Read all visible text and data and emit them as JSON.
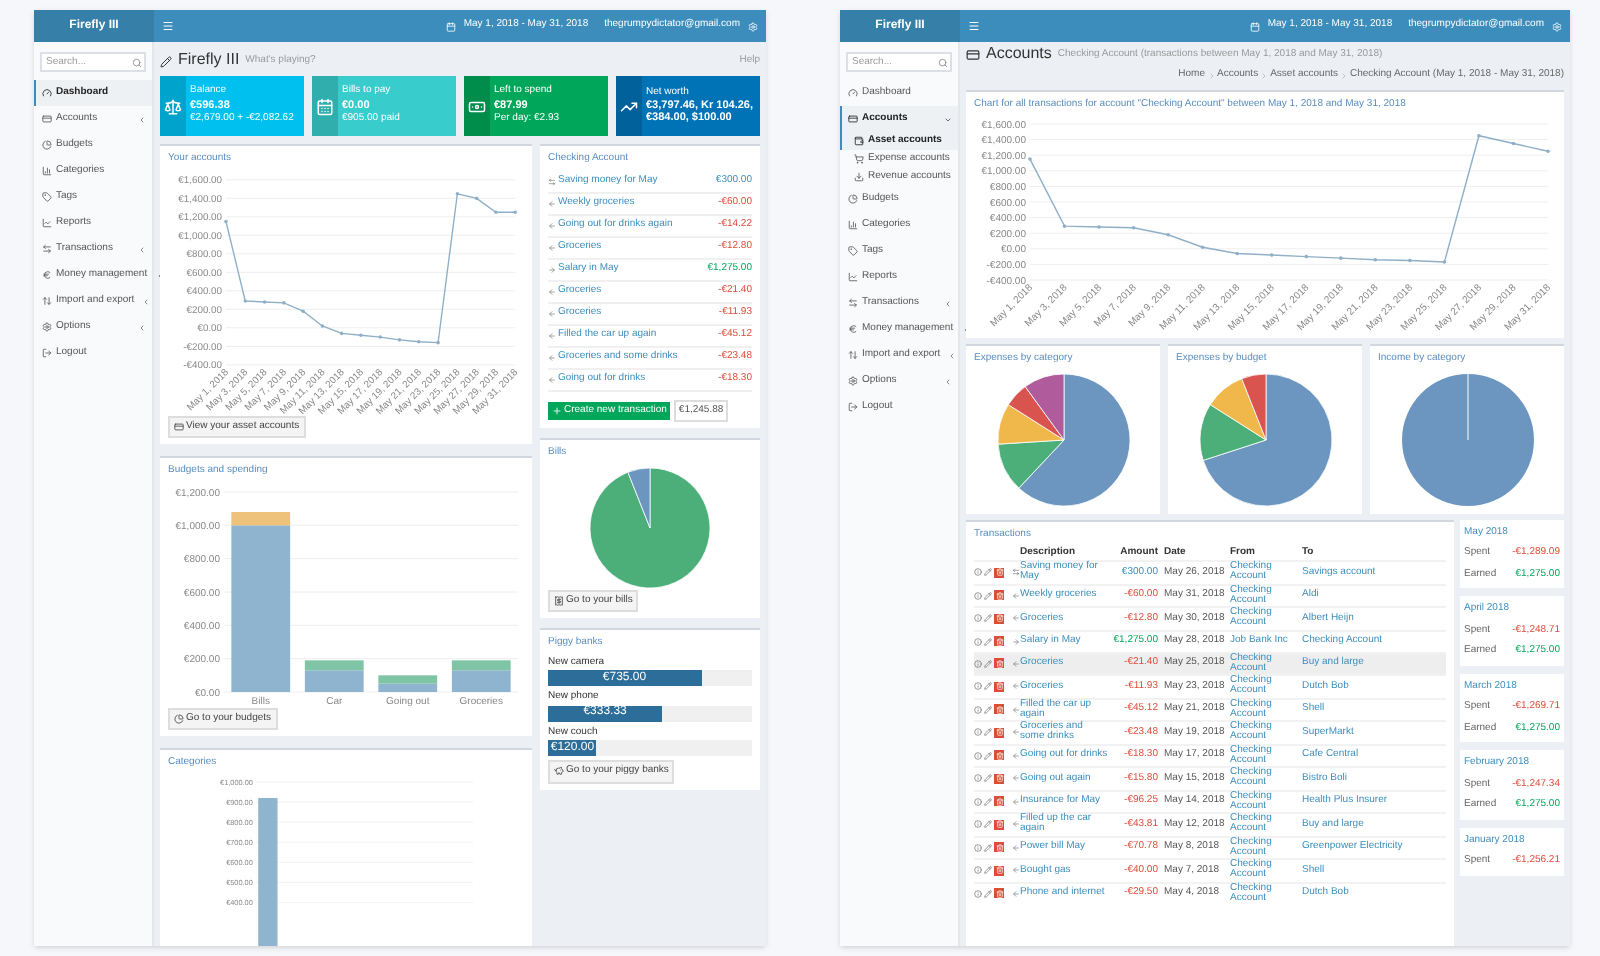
{
  "dashboard": {
    "header": {
      "brand": "Firefly III",
      "date_range": "May 1, 2018 - May 31, 2018",
      "user": "thegrumpydictator@gmail.com"
    },
    "search": {
      "placeholder": "Search..."
    },
    "menu": [
      {
        "kind": "dashboard",
        "label": "Dashboard",
        "selected": true
      },
      {
        "kind": "accounts",
        "label": "Accounts",
        "selected": false,
        "expanded": false
      },
      {
        "kind": "budgets",
        "label": "Budgets",
        "selected": false
      },
      {
        "kind": "categories",
        "label": "Categories",
        "selected": false
      },
      {
        "kind": "tags",
        "label": "Tags",
        "selected": false
      },
      {
        "kind": "reports",
        "label": "Reports",
        "selected": false
      },
      {
        "kind": "transactions",
        "label": "Transactions",
        "selected": false,
        "expanded": false
      },
      {
        "kind": "money",
        "label": "Money management",
        "selected": false,
        "expanded": false
      },
      {
        "kind": "import",
        "label": "Import and export",
        "selected": false,
        "expanded": false
      },
      {
        "kind": "options",
        "label": "Options",
        "selected": false,
        "expanded": false
      },
      {
        "kind": "logout",
        "label": "Logout",
        "selected": false
      }
    ],
    "title": "Firefly III",
    "subtitle": "What's playing?",
    "help": "Help",
    "info_boxes": [
      {
        "kind": "balance",
        "color": "#00c0ef",
        "label": "Balance",
        "value": "€596.38",
        "detail": "€2,679.00 + -€2,082.62"
      },
      {
        "kind": "bills",
        "color": "#39cccc",
        "label": "Bills to pay",
        "value": "€0.00",
        "detail": "€905.00 paid"
      },
      {
        "kind": "left",
        "color": "#00a65a",
        "label": "Left to spend",
        "value": "€87.99",
        "detail": "Per day: €2.93"
      },
      {
        "kind": "networth",
        "color": "#0073b7",
        "label": "Net worth",
        "value": "€3,797.46, Kr 104.26, €384.00, $100.00"
      }
    ],
    "your_accounts": {
      "title": "Your accounts",
      "button": "View your asset accounts",
      "chart_data": {
        "type": "line",
        "grid": true,
        "categories": [
          "May 1, 2018",
          "May 3, 2018",
          "May 5, 2018",
          "May 7, 2018",
          "May 9, 2018",
          "May 11, 2018",
          "May 13, 2018",
          "May 15, 2018",
          "May 17, 2018",
          "May 19, 2018",
          "May 21, 2018",
          "May 23, 2018",
          "May 25, 2018",
          "May 27, 2018",
          "May 29, 2018",
          "May 31, 2018"
        ],
        "series": [
          {
            "color": "#8fafc7",
            "values": [
              1150,
              290,
              280,
              270,
              180,
              20,
              -60,
              -80,
              -100,
              -130,
              -150,
              -160,
              1450,
              1400,
              1250,
              1250
            ]
          }
        ],
        "ylim": [
          -400,
          1600
        ],
        "yticks": [
          {
            "value": 1600,
            "label": "€1,600.00"
          },
          {
            "value": 1400,
            "label": "€1,400.00"
          },
          {
            "value": 1200,
            "label": "€1,200.00"
          },
          {
            "value": 1000,
            "label": "€1,000.00"
          },
          {
            "value": 800,
            "label": "€800.00"
          },
          {
            "value": 600,
            "label": "€600.00"
          },
          {
            "value": 400,
            "label": "€400.00"
          },
          {
            "value": 200,
            "label": "€200.00"
          },
          {
            "value": 0,
            "label": "€0.00"
          },
          {
            "value": -200,
            "label": "-€200.00"
          },
          {
            "value": -400,
            "label": "-€400.00"
          }
        ]
      }
    },
    "checking": {
      "title": "Checking Account",
      "transactions": [
        {
          "kind": "transfer",
          "description": "Saving money for May",
          "amount": "€300.00"
        },
        {
          "kind": "withdrawal",
          "description": "Weekly groceries",
          "amount": "-€60.00"
        },
        {
          "kind": "withdrawal",
          "description": "Going out for drinks again",
          "amount": "-€14.22"
        },
        {
          "kind": "withdrawal",
          "description": "Groceries",
          "amount": "-€12.80"
        },
        {
          "kind": "deposit",
          "description": "Salary in May",
          "amount": "€1,275.00"
        },
        {
          "kind": "withdrawal",
          "description": "Groceries",
          "amount": "-€21.40"
        },
        {
          "kind": "withdrawal",
          "description": "Groceries",
          "amount": "-€11.93"
        },
        {
          "kind": "withdrawal",
          "description": "Filled the car up again",
          "amount": "-€45.12"
        },
        {
          "kind": "withdrawal",
          "description": "Groceries and some drinks",
          "amount": "-€23.48"
        },
        {
          "kind": "withdrawal",
          "description": "Going out for drinks",
          "amount": "-€18.30"
        }
      ],
      "create_button": "Create new transaction",
      "balance": "€1,245.88"
    },
    "budgets": {
      "title": "Budgets and spending",
      "button": "Go to your budgets",
      "chart_data": {
        "type": "bar",
        "stacked": true,
        "grid": true,
        "categories": [
          "Bills",
          "Car",
          "Going out",
          "Groceries"
        ],
        "series": [
          {
            "color": "#8fb4cf",
            "values": [
              1000,
              130,
              50,
              130
            ]
          },
          {
            "color": "#7fc4a4",
            "values": [
              0,
              60,
              50,
              60
            ]
          },
          {
            "color": "#eec27a",
            "values": [
              80,
              0,
              0,
              0
            ]
          }
        ],
        "ylim": [
          0,
          1200
        ],
        "yticks": [
          {
            "value": 1200,
            "label": "€1,200.00"
          },
          {
            "value": 1000,
            "label": "€1,000.00"
          },
          {
            "value": 800,
            "label": "€800.00"
          },
          {
            "value": 600,
            "label": "€600.00"
          },
          {
            "value": 400,
            "label": "€400.00"
          },
          {
            "value": 200,
            "label": "€200.00"
          },
          {
            "value": 0,
            "label": "€0.00"
          }
        ]
      }
    },
    "bills": {
      "title": "Bills",
      "button": "Go to your bills"
    },
    "piggy_banks": {
      "title": "Piggy banks",
      "items": [
        {
          "name": "New camera",
          "amount": "€735.00",
          "level": 0.75
        },
        {
          "name": "New phone",
          "amount": "€333.33",
          "level": 0.56
        },
        {
          "name": "New couch",
          "amount": "€120.00",
          "level": 0.24
        }
      ],
      "button": "Go to your piggy banks"
    },
    "categories": {
      "title": "Categories",
      "chart_data": {
        "type": "bar",
        "grid": true,
        "series": [
          {
            "color": "#8fb4cf",
            "values": [
              920
            ]
          }
        ],
        "ylim": [
          0,
          1000
        ],
        "yticks": [
          {
            "value": 1000,
            "label": "€1,000.00"
          },
          {
            "value": 900,
            "label": "€900.00"
          },
          {
            "value": 800,
            "label": "€800.00"
          },
          {
            "value": 700,
            "label": "€700.00"
          },
          {
            "value": 600,
            "label": "€600.00"
          },
          {
            "value": 500,
            "label": "€500.00"
          },
          {
            "value": 400,
            "label": "€400.00"
          }
        ]
      }
    }
  },
  "account_page": {
    "header": {
      "brand": "Firefly III",
      "date_range": "May 1, 2018 - May 31, 2018",
      "user": "thegrumpydictator@gmail.com"
    },
    "search": {
      "placeholder": "Search..."
    },
    "menu": [
      {
        "kind": "dashboard",
        "label": "Dashboard",
        "selected": false
      },
      {
        "kind": "accounts",
        "label": "Accounts",
        "selected": true,
        "expanded": true,
        "children": [
          {
            "kind": "asset",
            "label": "Asset accounts",
            "selected": true
          },
          {
            "kind": "expense",
            "label": "Expense accounts",
            "selected": false
          },
          {
            "kind": "revenue",
            "label": "Revenue accounts",
            "selected": false
          }
        ]
      },
      {
        "kind": "budgets",
        "label": "Budgets",
        "selected": false
      },
      {
        "kind": "categories",
        "label": "Categories",
        "selected": false
      },
      {
        "kind": "tags",
        "label": "Tags",
        "selected": false
      },
      {
        "kind": "reports",
        "label": "Reports",
        "selected": false
      },
      {
        "kind": "transactions",
        "label": "Transactions",
        "selected": false,
        "expanded": false
      },
      {
        "kind": "money",
        "label": "Money management",
        "selected": false,
        "expanded": false
      },
      {
        "kind": "import",
        "label": "Import and export",
        "selected": false,
        "expanded": false
      },
      {
        "kind": "options",
        "label": "Options",
        "selected": false,
        "expanded": false
      },
      {
        "kind": "logout",
        "label": "Logout",
        "selected": false
      }
    ],
    "title": "Accounts",
    "subtitle": "Checking Account (transactions between May 1, 2018 and May 31, 2018)",
    "breadcrumbs": [
      "Home",
      "Accounts",
      "Asset accounts",
      "Checking Account (May 1, 2018 - May 31, 2018)"
    ],
    "chart": {
      "title": "Chart for all transactions for account \"Checking Account\" between May 1, 2018 and May 31, 2018",
      "chart_data": {
        "type": "line",
        "grid": true,
        "categories": [
          "May 1, 2018",
          "May 3, 2018",
          "May 5, 2018",
          "May 7, 2018",
          "May 9, 2018",
          "May 11, 2018",
          "May 13, 2018",
          "May 15, 2018",
          "May 17, 2018",
          "May 19, 2018",
          "May 21, 2018",
          "May 23, 2018",
          "May 25, 2018",
          "May 27, 2018",
          "May 29, 2018",
          "May 31, 2018"
        ],
        "series": [
          {
            "color": "#8fafc7",
            "values": [
              1150,
              290,
              280,
              270,
              180,
              20,
              -60,
              -80,
              -100,
              -120,
              -140,
              -150,
              -170,
              1450,
              1350,
              1250
            ]
          }
        ],
        "ylim": [
          -400,
          1600
        ],
        "yticks": [
          {
            "value": 1600,
            "label": "€1,600.00"
          },
          {
            "value": 1400,
            "label": "€1,400.00"
          },
          {
            "value": 1200,
            "label": "€1,200.00"
          },
          {
            "value": 1000,
            "label": "€1,000.00"
          },
          {
            "value": 800,
            "label": "€800.00"
          },
          {
            "value": 600,
            "label": "€600.00"
          },
          {
            "value": 400,
            "label": "€400.00"
          },
          {
            "value": 200,
            "label": "€200.00"
          },
          {
            "value": 0,
            "label": "€0.00"
          },
          {
            "value": -200,
            "label": "-€200.00"
          },
          {
            "value": -400,
            "label": "-€400.00"
          }
        ]
      }
    },
    "pies": [
      {
        "kind": "expense_category",
        "title": "Expenses by category"
      },
      {
        "kind": "expense_budget",
        "title": "Expenses by budget"
      },
      {
        "kind": "income_category",
        "title": "Income by category"
      }
    ],
    "transactions": {
      "title": "Transactions",
      "columns": [
        "Description",
        "Amount",
        "Date",
        "From",
        "To"
      ],
      "rows": [
        {
          "kind": "transfer",
          "selected": false,
          "description": "Saving money for May",
          "amount": "€300.00",
          "date": "May 26, 2018",
          "from": "Checking Account",
          "to": "Savings account"
        },
        {
          "kind": "withdrawal",
          "selected": false,
          "description": "Weekly groceries",
          "amount": "-€60.00",
          "date": "May 31, 2018",
          "from": "Checking Account",
          "to": "Aldi"
        },
        {
          "kind": "withdrawal",
          "selected": false,
          "description": "Groceries",
          "amount": "-€12.80",
          "date": "May 30, 2018",
          "from": "Checking Account",
          "to": "Albert Heijn"
        },
        {
          "kind": "deposit",
          "selected": false,
          "description": "Salary in May",
          "amount": "€1,275.00",
          "date": "May 28, 2018",
          "from": "Job Bank Inc",
          "to": "Checking Account"
        },
        {
          "kind": "withdrawal",
          "selected": true,
          "description": "Groceries",
          "amount": "-€21.40",
          "date": "May 25, 2018",
          "from": "Checking Account",
          "to": "Buy and large"
        },
        {
          "kind": "withdrawal",
          "selected": false,
          "description": "Groceries",
          "amount": "-€11.93",
          "date": "May 23, 2018",
          "from": "Checking Account",
          "to": "Dutch Bob"
        },
        {
          "kind": "withdrawal",
          "selected": false,
          "description": "Filled the car up again",
          "amount": "-€45.12",
          "date": "May 21, 2018",
          "from": "Checking Account",
          "to": "Shell"
        },
        {
          "kind": "withdrawal",
          "selected": false,
          "description": "Groceries and some drinks",
          "amount": "-€23.48",
          "date": "May 19, 2018",
          "from": "Checking Account",
          "to": "SuperMarkt"
        },
        {
          "kind": "withdrawal",
          "selected": false,
          "description": "Going out for drinks",
          "amount": "-€18.30",
          "date": "May 17, 2018",
          "from": "Checking Account",
          "to": "Cafe Central"
        },
        {
          "kind": "withdrawal",
          "selected": false,
          "description": "Going out again",
          "amount": "-€15.80",
          "date": "May 15, 2018",
          "from": "Checking Account",
          "to": "Bistro Boli"
        },
        {
          "kind": "withdrawal",
          "selected": false,
          "description": "Insurance for May",
          "amount": "-€96.25",
          "date": "May 14, 2018",
          "from": "Checking Account",
          "to": "Health Plus Insurer"
        },
        {
          "kind": "withdrawal",
          "selected": false,
          "description": "Filled up the car again",
          "amount": "-€43.81",
          "date": "May 12, 2018",
          "from": "Checking Account",
          "to": "Buy and large"
        },
        {
          "kind": "withdrawal",
          "selected": false,
          "description": "Power bill May",
          "amount": "-€70.78",
          "date": "May 8, 2018",
          "from": "Checking Account",
          "to": "Greenpower Electricity"
        },
        {
          "kind": "withdrawal",
          "selected": false,
          "description": "Bought gas",
          "amount": "-€40.00",
          "date": "May 7, 2018",
          "from": "Checking Account",
          "to": "Shell"
        },
        {
          "kind": "withdrawal",
          "selected": false,
          "description": "Phone and internet",
          "amount": "-€29.50",
          "date": "May 4, 2018",
          "from": "Checking Account",
          "to": "Dutch Bob"
        }
      ]
    },
    "months": [
      {
        "title": "May 2018",
        "rows": [
          {
            "kind": "spent",
            "label": "Spent",
            "amount": "-€1,289.09"
          },
          {
            "kind": "earned",
            "label": "Earned",
            "amount": "€1,275.00"
          }
        ]
      },
      {
        "title": "April 2018",
        "rows": [
          {
            "kind": "spent",
            "label": "Spent",
            "amount": "-€1,248.71"
          },
          {
            "kind": "earned",
            "label": "Earned",
            "amount": "€1,275.00"
          }
        ]
      },
      {
        "title": "March 2018",
        "rows": [
          {
            "kind": "spent",
            "label": "Spent",
            "amount": "-€1,269.71"
          },
          {
            "kind": "earned",
            "label": "Earned",
            "amount": "€1,275.00"
          }
        ]
      },
      {
        "title": "February 2018",
        "rows": [
          {
            "kind": "spent",
            "label": "Spent",
            "amount": "-€1,247.34"
          },
          {
            "kind": "earned",
            "label": "Earned",
            "amount": "€1,275.00"
          }
        ]
      },
      {
        "title": "January 2018",
        "rows": [
          {
            "kind": "spent",
            "label": "Spent",
            "amount": "-€1,256.21"
          }
        ]
      }
    ]
  }
}
